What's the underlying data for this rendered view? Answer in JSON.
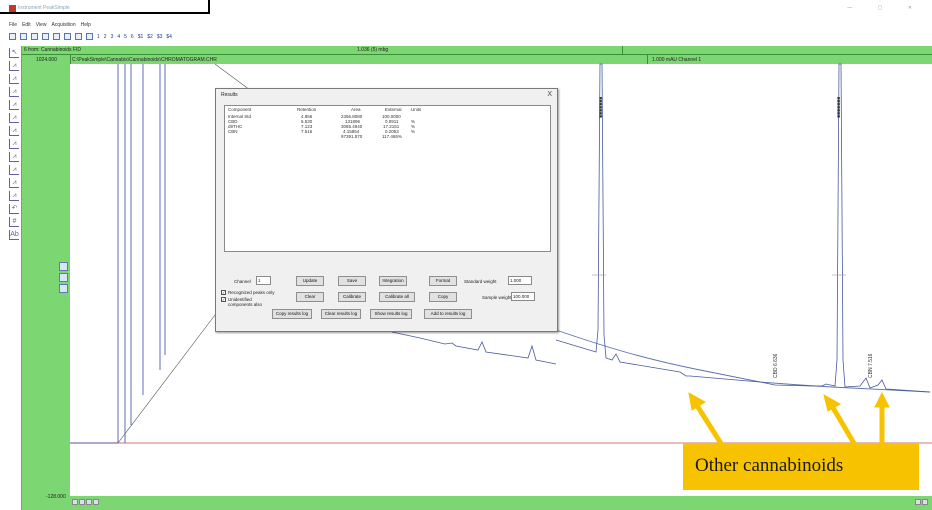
{
  "app": {
    "title": "Instrument PeakSimple",
    "menu": [
      "File",
      "Edit",
      "View",
      "Acquisition",
      "Help"
    ],
    "toolbar_numbers": [
      "1",
      "2",
      "3",
      "4",
      "5",
      "6"
    ],
    "toolbar_right": [
      "$1",
      "$2",
      "$3",
      "$4"
    ]
  },
  "plot": {
    "channel_label": "6 from: Cannabinoids FID",
    "mid_label": "1.036 (5) mbg",
    "right_label": "1.000 mAU Channel 1",
    "ymax_label": "1024.000",
    "file_path": "C:\\PeakSimple\\Cannabis\\Cannabinoids\\CHROMATOGRAM.CHR",
    "ymin_label": "-128.000",
    "peak_labels": [
      "CBD 6.636",
      "CBN 7.516"
    ],
    "colors": {
      "green": "#7cd672",
      "trace": "#5b6fae",
      "baseline": "#c94a4a",
      "accent": "#f7c300"
    }
  },
  "dialog": {
    "title": "Results",
    "close_glyph": "X",
    "columns": [
      "Component",
      "Retention",
      "Area",
      "External",
      "Units"
    ],
    "rows": [
      {
        "component": "Internal Std",
        "retention": "4.856",
        "area": "2356.8080",
        "external": "100.0000",
        "units": ""
      },
      {
        "component": "CBD",
        "retention": "6.530",
        "area": "131896",
        "external": "0.0911",
        "units": "%"
      },
      {
        "component": "d9THC",
        "retention": "7.123",
        "area": "3065.4940",
        "external": "17.2151",
        "units": "%"
      },
      {
        "component": "CBN",
        "retention": "7.516",
        "area": "4.15854",
        "external": "0.2053",
        "units": "%"
      },
      {
        "component": "",
        "retention": "",
        "area": "97391.570",
        "external": "117.465%",
        "units": ""
      }
    ],
    "channel_label": "Channel",
    "channel_value": "1",
    "buttons": {
      "update": "Update",
      "save": "Save",
      "integration": "Integration",
      "format": "Format",
      "clear": "Clear",
      "calibrate": "Calibrate",
      "calibrate_all": "Calibrate all",
      "copy": "Copy",
      "copy_results_log": "Copy results log",
      "clear_results_log": "Clear results log",
      "show_results_log": "Show results log",
      "add_to_results_log": "Add to results log"
    },
    "standard_weight_label": "Standard weight",
    "standard_weight_value": "1.000",
    "sample_weight_label": "Sample weight",
    "sample_weight_value": "100.000",
    "recognized_label": "Recognized peaks only",
    "unidentified_label": "Unidentified components also"
  },
  "annotation": {
    "text": "Other cannabinoids"
  }
}
